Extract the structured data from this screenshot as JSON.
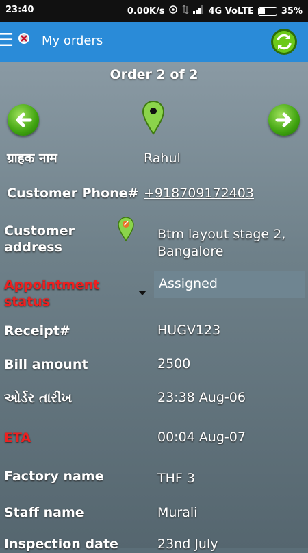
{
  "status_bar": {
    "time": "23:40",
    "speed": "0.00K/s",
    "network": "4G VoLTE",
    "battery": "35%",
    "battery_level": 0.35
  },
  "toolbar": {
    "title": "My orders",
    "icons": [
      "hamburger-menu-icon",
      "app-logo-icon",
      "refresh-icon"
    ]
  },
  "order": {
    "header": "Order 2 of 2",
    "fields": {
      "customer_name_label": "ग्राहक नाम",
      "customer_name": "Rahul",
      "phone_label": "Customer Phone#",
      "phone": "+918709172403",
      "address_label": "Customer address",
      "address": "Btm layout stage 2, Bangalore",
      "appointment_label": "Appointment status",
      "appointment_status": "Assigned",
      "receipt_label": "Receipt#",
      "receipt": "HUGV123",
      "bill_label": "Bill amount",
      "bill": "2500",
      "order_date_label": "ઓર્ડર તારીખ",
      "order_date": "23:38 Aug-06",
      "eta_label": "ETA",
      "eta": "00:04 Aug-07",
      "factory_label": "Factory name",
      "factory": "THF 3",
      "staff_label": "Staff name",
      "staff": "Murali",
      "inspection_label": "Inspection date",
      "inspection": "23nd July"
    }
  },
  "colors": {
    "toolbar": "#2a8bd8",
    "accent_green": "#3fa30f",
    "label_red": "#ee2020"
  }
}
